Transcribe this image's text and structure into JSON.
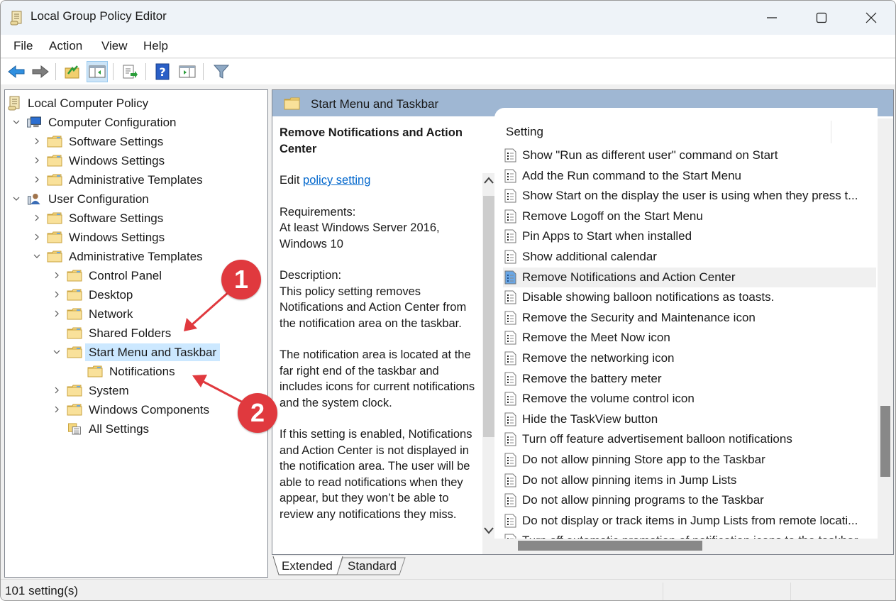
{
  "window": {
    "title": "Local Group Policy Editor",
    "controls": {
      "minimize": "minimize",
      "maximize": "maximize",
      "close": "close"
    }
  },
  "menu": [
    "File",
    "Action",
    "View",
    "Help"
  ],
  "toolbar": [
    {
      "name": "back",
      "icon": "arrow-left-icon"
    },
    {
      "name": "forward",
      "icon": "arrow-right-icon"
    },
    {
      "name": "up-one-level",
      "icon": "folder-up-icon"
    },
    {
      "name": "show-hide-console-tree",
      "icon": "console-tree-icon",
      "active": true
    },
    {
      "name": "export-list",
      "icon": "export-list-icon"
    },
    {
      "name": "help",
      "icon": "help-icon"
    },
    {
      "name": "show-hide-action-pane",
      "icon": "action-pane-icon"
    },
    {
      "name": "filter",
      "icon": "filter-icon"
    }
  ],
  "tree": {
    "root": "Local Computer Policy",
    "items": [
      {
        "label": "Computer Configuration",
        "level": 1,
        "expander": "expanded",
        "icon": "computer-icon"
      },
      {
        "label": "Software Settings",
        "level": 2,
        "expander": "collapsed",
        "icon": "folder-icon"
      },
      {
        "label": "Windows Settings",
        "level": 2,
        "expander": "collapsed",
        "icon": "folder-icon"
      },
      {
        "label": "Administrative Templates",
        "level": 2,
        "expander": "collapsed",
        "icon": "folder-icon"
      },
      {
        "label": "User Configuration",
        "level": 1,
        "expander": "expanded",
        "icon": "user-icon"
      },
      {
        "label": "Software Settings",
        "level": 2,
        "expander": "collapsed",
        "icon": "folder-icon"
      },
      {
        "label": "Windows Settings",
        "level": 2,
        "expander": "collapsed",
        "icon": "folder-icon"
      },
      {
        "label": "Administrative Templates",
        "level": 2,
        "expander": "expanded",
        "icon": "folder-icon"
      },
      {
        "label": "Control Panel",
        "level": 3,
        "expander": "collapsed",
        "icon": "folder-icon"
      },
      {
        "label": "Desktop",
        "level": 3,
        "expander": "collapsed",
        "icon": "folder-icon"
      },
      {
        "label": "Network",
        "level": 3,
        "expander": "collapsed",
        "icon": "folder-icon"
      },
      {
        "label": "Shared Folders",
        "level": 3,
        "expander": "none",
        "icon": "folder-icon"
      },
      {
        "label": "Start Menu and Taskbar",
        "level": 3,
        "expander": "expanded",
        "icon": "folder-icon",
        "selected": true
      },
      {
        "label": "Notifications",
        "level": 4,
        "expander": "none",
        "icon": "folder-icon"
      },
      {
        "label": "System",
        "level": 3,
        "expander": "collapsed",
        "icon": "folder-icon"
      },
      {
        "label": "Windows Components",
        "level": 3,
        "expander": "collapsed",
        "icon": "folder-icon"
      },
      {
        "label": "All Settings",
        "level": 3,
        "expander": "none",
        "icon": "all-settings-icon"
      }
    ]
  },
  "content": {
    "header": "Start Menu and Taskbar",
    "description": {
      "title": "Remove Notifications and Action Center",
      "edit_prefix": "Edit ",
      "edit_link": "policy setting ",
      "requirements_label": "Requirements:",
      "requirements": "At least Windows Server 2016, Windows 10",
      "description_label": "Description:",
      "paragraphs": [
        "This policy setting removes Notifications and Action Center from the notification area on the taskbar.",
        "The notification area is located at the far right end of the taskbar and includes icons for current notifications and the system clock.",
        "If this setting is enabled, Notifications and Action Center is not displayed in the notification area. The user will be able to read notifications when they appear, but they won’t be able to review any notifications they miss."
      ]
    },
    "list_header": "Setting",
    "settings": [
      "Show \"Run as different user\" command on Start",
      "Add the Run command to the Start Menu",
      "Show Start on the display the user is using when they press t...",
      "Remove Logoff on the Start Menu",
      "Pin Apps to Start when installed",
      "Show additional calendar",
      "Remove Notifications and Action Center",
      "Disable showing balloon notifications as toasts.",
      "Remove the Security and Maintenance icon",
      "Remove the Meet Now icon",
      "Remove the networking icon",
      "Remove the battery meter",
      "Remove the volume control icon",
      "Hide the TaskView button",
      "Turn off feature advertisement balloon notifications",
      "Do not allow pinning Store app to the Taskbar",
      "Do not allow pinning items in Jump Lists",
      "Do not allow pinning programs to the Taskbar",
      "Do not display or track items in Jump Lists from remote locati...",
      "Turn off automatic promotion of notification icons to the taskbar"
    ],
    "selected_setting_index": 6
  },
  "tabs": [
    {
      "label": "Extended",
      "active": true
    },
    {
      "label": "Standard",
      "active": false
    }
  ],
  "status": "101 setting(s)",
  "annotations": [
    {
      "number": "1",
      "target": "Start Menu and Taskbar"
    },
    {
      "number": "2",
      "target": "Notifications"
    }
  ],
  "colors": {
    "callout": "#e0393e",
    "header": "#9fb7d3",
    "selection": "#cce8ff",
    "link": "#0066cc"
  }
}
